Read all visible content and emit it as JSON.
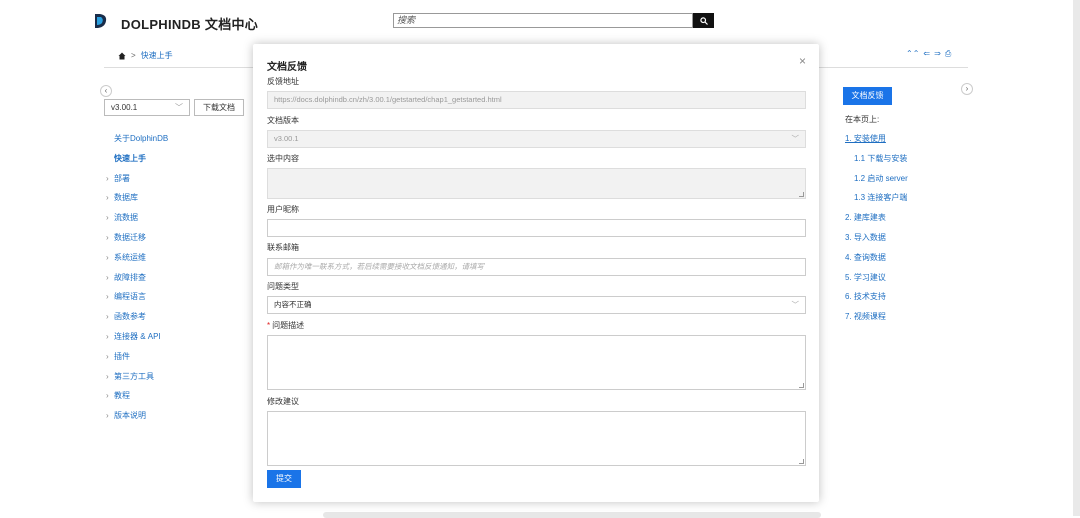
{
  "header": {
    "brand": "DOLPHINDB 文档中心",
    "search_placeholder": "搜索"
  },
  "breadcrumb": {
    "items": [
      "快速上手"
    ]
  },
  "tools": [
    "⌃⌃",
    "⇐",
    "⇒",
    "⎙"
  ],
  "sidebar": {
    "version": "v3.00.1",
    "download_label": "下载文档",
    "items": [
      {
        "label": "关于DolphinDB",
        "arrow": false
      },
      {
        "label": "快速上手",
        "arrow": false
      },
      {
        "label": "部署",
        "arrow": true
      },
      {
        "label": "数据库",
        "arrow": true
      },
      {
        "label": "流数据",
        "arrow": true
      },
      {
        "label": "数据迁移",
        "arrow": true
      },
      {
        "label": "系统运维",
        "arrow": true
      },
      {
        "label": "故障排查",
        "arrow": true
      },
      {
        "label": "编程语言",
        "arrow": true
      },
      {
        "label": "函数参考",
        "arrow": true
      },
      {
        "label": "连接器 & API",
        "arrow": true
      },
      {
        "label": "插件",
        "arrow": true
      },
      {
        "label": "第三方工具",
        "arrow": true
      },
      {
        "label": "教程",
        "arrow": true
      },
      {
        "label": "版本说明",
        "arrow": true
      }
    ]
  },
  "right_panel": {
    "feedback_label": "文档反馈",
    "toc_title": "在本页上:",
    "toc": [
      {
        "label": "1. 安装使用",
        "sub": false
      },
      {
        "label": "1.1 下载与安装",
        "sub": true
      },
      {
        "label": "1.2 启动 server",
        "sub": true
      },
      {
        "label": "1.3 连接客户端",
        "sub": true
      },
      {
        "label": "2. 建库建表",
        "sub": false
      },
      {
        "label": "3. 导入数据",
        "sub": false
      },
      {
        "label": "4. 查询数据",
        "sub": false
      },
      {
        "label": "5. 学习建议",
        "sub": false
      },
      {
        "label": "6. 技术支持",
        "sub": false
      },
      {
        "label": "7. 视频课程",
        "sub": false
      }
    ]
  },
  "modal": {
    "title": "文档反馈",
    "close": "×",
    "url_label": "反馈地址",
    "url_value": "https://docs.dolphindb.cn/zh/3.00.1/getstarted/chap1_getstarted.html",
    "version_label": "文档版本",
    "version_value": "v3.00.1",
    "selection_label": "选中内容",
    "nickname_label": "用户昵称",
    "email_label": "联系邮箱",
    "email_placeholder": "邮箱作为唯一联系方式，若后续需要接收文档反馈通知，请填写",
    "type_label": "问题类型",
    "type_value": "内容不正确",
    "desc_required": "*",
    "desc_label": "问题描述",
    "suggest_label": "修改建议",
    "submit_label": "提交"
  }
}
